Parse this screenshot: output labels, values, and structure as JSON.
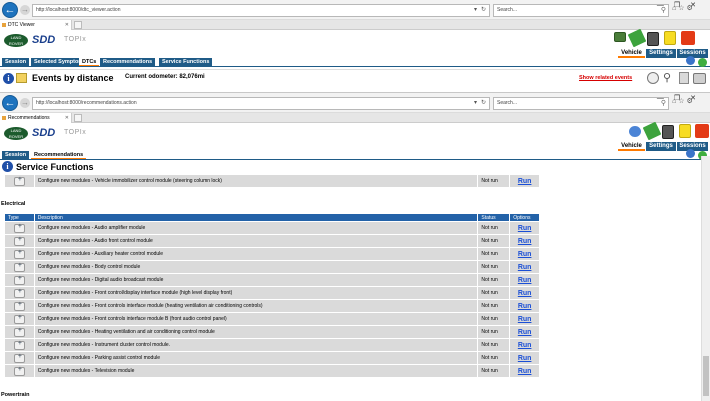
{
  "window1": {
    "url": "http://localhost:8000/dtc_viewer.action",
    "search_placeholder": "Search...",
    "tab_title": "DTC Viewer",
    "brand": {
      "logo_text": "LAND ROVER",
      "sdd": "SDD",
      "topix": "TOPIx"
    },
    "nav_tabs": [
      "Vehicle",
      "Settings",
      "Sessions"
    ],
    "menu": [
      "Session",
      "Selected Symptoms",
      "DTCs",
      "Recommendations",
      "Service Functions"
    ],
    "active_menu": "DTCs",
    "events": {
      "title": "Events by distance",
      "odometer": "Current odometer: 82,076mi",
      "related_link": "Show related events"
    }
  },
  "window2": {
    "url": "http://localhost:8000/recommendations.action",
    "search_placeholder": "Search...",
    "tab_title": "Recommendations",
    "brand": {
      "logo_text": "LAND ROVER",
      "sdd": "SDD",
      "topix": "TOPIx"
    },
    "nav_tabs": [
      "Vehicle",
      "Settings",
      "Sessions"
    ],
    "menu": [
      "Session",
      "Recommendations"
    ],
    "active_menu": "Recommendations",
    "page_title": "Service Functions",
    "top_row": {
      "description": "Configure new modules - Vehicle immobilizer control module (steering column lock)",
      "status": "Not run",
      "option": "Run"
    },
    "sections": [
      {
        "label": "Electrical",
        "headers": [
          "Type",
          "Description",
          "Status",
          "Options"
        ],
        "rows": [
          {
            "description": "Configure new modules - Audio amplifier module",
            "status": "Not run",
            "option": "Run"
          },
          {
            "description": "Configure new modules - Audio front control module",
            "status": "Not run",
            "option": "Run"
          },
          {
            "description": "Configure new modules - Auxiliary heater control module",
            "status": "Not run",
            "option": "Run"
          },
          {
            "description": "Configure new modules - Body control module",
            "status": "Not run",
            "option": "Run"
          },
          {
            "description": "Configure new modules - Digital audio broadcast module",
            "status": "Not run",
            "option": "Run"
          },
          {
            "description": "Configure new modules - Front control/display interface module (high level display front)",
            "status": "Not run",
            "option": "Run"
          },
          {
            "description": "Configure new modules - Front controls interface module (heating ventilation air conditioning controls)",
            "status": "Not run",
            "option": "Run"
          },
          {
            "description": "Configure new modules - Front controls interface module B (front audio control panel)",
            "status": "Not run",
            "option": "Run"
          },
          {
            "description": "Configure new modules - Heating ventilation and air conditioning control module",
            "status": "Not run",
            "option": "Run"
          },
          {
            "description": "Configure new modules - Instrument cluster control module.",
            "status": "Not run",
            "option": "Run"
          },
          {
            "description": "Configure new modules - Parking assist control module",
            "status": "Not run",
            "option": "Run"
          },
          {
            "description": "Configure new modules - Television module",
            "status": "Not run",
            "option": "Run"
          }
        ]
      },
      {
        "label": "Powertrain"
      }
    ]
  },
  "colors": {
    "brand_blue": "#1f5b87",
    "table_header": "#2362a8",
    "accent_orange": "#ff7a00",
    "link_red": "#d60000",
    "run_blue": "#1b4fd6"
  }
}
